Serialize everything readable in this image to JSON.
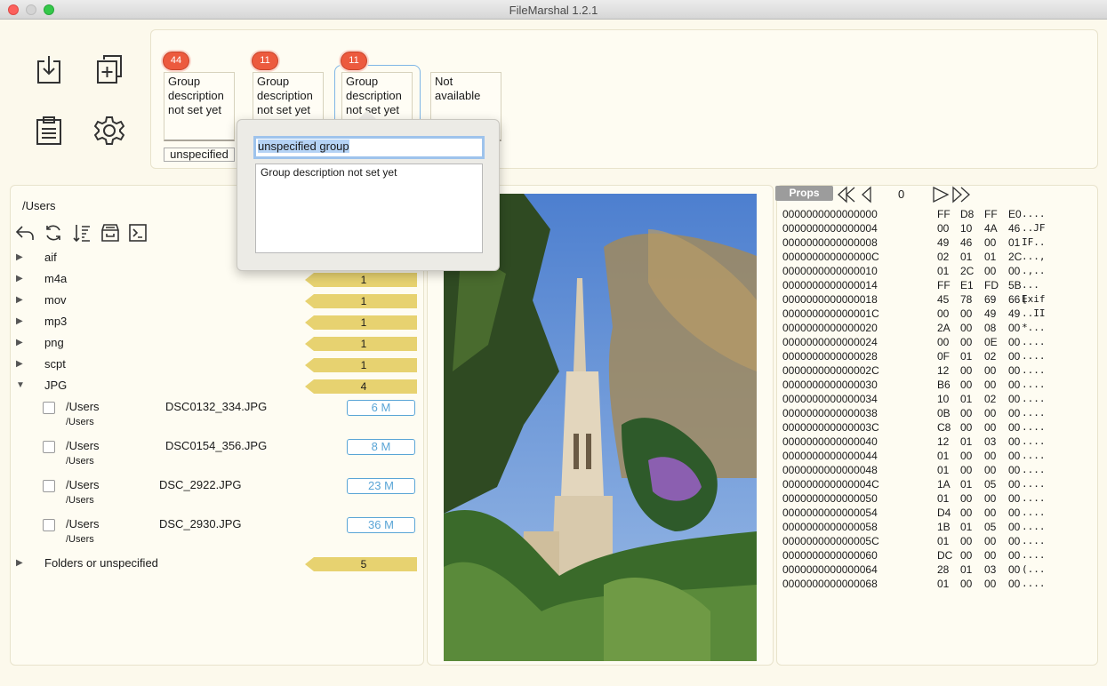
{
  "window": {
    "title": "FileMarshal 1.2.1"
  },
  "toolbar": {
    "icons": [
      "download-icon",
      "add-copy-icon",
      "clipboard-icon",
      "settings-icon"
    ]
  },
  "groups": [
    {
      "badge": "44",
      "description": "Group description not set yet",
      "label": "unspecified"
    },
    {
      "badge": "11",
      "description": "Group description not set yet",
      "label": ""
    },
    {
      "badge": "11",
      "description": "Group description not set yet",
      "label": ""
    },
    {
      "badge": "",
      "description": "Not available",
      "label": ""
    }
  ],
  "popover": {
    "name_value": "unspecified group",
    "description_value": "Group description not set yet"
  },
  "browser": {
    "path": "/Users",
    "tools": [
      "back-icon",
      "refresh-icon",
      "sort-icon",
      "archive-icon",
      "terminal-icon"
    ],
    "rows": [
      {
        "ext": "aif",
        "count": ""
      },
      {
        "ext": "m4a",
        "count": "1"
      },
      {
        "ext": "mov",
        "count": "1"
      },
      {
        "ext": "mp3",
        "count": "1"
      },
      {
        "ext": "png",
        "count": "1"
      },
      {
        "ext": "scpt",
        "count": "1"
      },
      {
        "ext": "JPG",
        "count": "4"
      }
    ],
    "files": [
      {
        "path": "/Users",
        "subpath": "/Users",
        "name": "DSC0132_334.JPG",
        "size": "6 M"
      },
      {
        "path": "/Users",
        "subpath": "/Users",
        "name": "DSC0154_356.JPG",
        "size": "8 M"
      },
      {
        "path": "/Users",
        "subpath": "/Users",
        "name": "DSC_2922.JPG",
        "size": "23 M"
      },
      {
        "path": "/Users",
        "subpath": "/Users",
        "name": "DSC_2930.JPG",
        "size": "36 M"
      }
    ],
    "footer_row": {
      "label": "Folders or unspecified",
      "count": "5"
    }
  },
  "props": {
    "button_label": "Props",
    "page": "0",
    "rows": [
      {
        "offset": "0000000000000000",
        "bytes": [
          "FF",
          "D8",
          "FF",
          "E0"
        ],
        "ascii": "...."
      },
      {
        "offset": "0000000000000004",
        "bytes": [
          "00",
          "10",
          "4A",
          "46"
        ],
        "ascii": "..JF"
      },
      {
        "offset": "0000000000000008",
        "bytes": [
          "49",
          "46",
          "00",
          "01"
        ],
        "ascii": "IF.."
      },
      {
        "offset": "000000000000000C",
        "bytes": [
          "02",
          "01",
          "01",
          "2C"
        ],
        "ascii": "...,"
      },
      {
        "offset": "0000000000000010",
        "bytes": [
          "01",
          "2C",
          "00",
          "00"
        ],
        "ascii": ".,.."
      },
      {
        "offset": "0000000000000014",
        "bytes": [
          "FF",
          "E1",
          "FD",
          "5B"
        ],
        "ascii": "...["
      },
      {
        "offset": "0000000000000018",
        "bytes": [
          "45",
          "78",
          "69",
          "66"
        ],
        "ascii": "Exif"
      },
      {
        "offset": "000000000000001C",
        "bytes": [
          "00",
          "00",
          "49",
          "49"
        ],
        "ascii": "..II"
      },
      {
        "offset": "0000000000000020",
        "bytes": [
          "2A",
          "00",
          "08",
          "00"
        ],
        "ascii": "*..."
      },
      {
        "offset": "0000000000000024",
        "bytes": [
          "00",
          "00",
          "0E",
          "00"
        ],
        "ascii": "...."
      },
      {
        "offset": "0000000000000028",
        "bytes": [
          "0F",
          "01",
          "02",
          "00"
        ],
        "ascii": "...."
      },
      {
        "offset": "000000000000002C",
        "bytes": [
          "12",
          "00",
          "00",
          "00"
        ],
        "ascii": "...."
      },
      {
        "offset": "0000000000000030",
        "bytes": [
          "B6",
          "00",
          "00",
          "00"
        ],
        "ascii": "...."
      },
      {
        "offset": "0000000000000034",
        "bytes": [
          "10",
          "01",
          "02",
          "00"
        ],
        "ascii": "...."
      },
      {
        "offset": "0000000000000038",
        "bytes": [
          "0B",
          "00",
          "00",
          "00"
        ],
        "ascii": "...."
      },
      {
        "offset": "000000000000003C",
        "bytes": [
          "C8",
          "00",
          "00",
          "00"
        ],
        "ascii": "...."
      },
      {
        "offset": "0000000000000040",
        "bytes": [
          "12",
          "01",
          "03",
          "00"
        ],
        "ascii": "...."
      },
      {
        "offset": "0000000000000044",
        "bytes": [
          "01",
          "00",
          "00",
          "00"
        ],
        "ascii": "...."
      },
      {
        "offset": "0000000000000048",
        "bytes": [
          "01",
          "00",
          "00",
          "00"
        ],
        "ascii": "...."
      },
      {
        "offset": "000000000000004C",
        "bytes": [
          "1A",
          "01",
          "05",
          "00"
        ],
        "ascii": "...."
      },
      {
        "offset": "0000000000000050",
        "bytes": [
          "01",
          "00",
          "00",
          "00"
        ],
        "ascii": "...."
      },
      {
        "offset": "0000000000000054",
        "bytes": [
          "D4",
          "00",
          "00",
          "00"
        ],
        "ascii": "...."
      },
      {
        "offset": "0000000000000058",
        "bytes": [
          "1B",
          "01",
          "05",
          "00"
        ],
        "ascii": "...."
      },
      {
        "offset": "000000000000005C",
        "bytes": [
          "01",
          "00",
          "00",
          "00"
        ],
        "ascii": "...."
      },
      {
        "offset": "0000000000000060",
        "bytes": [
          "DC",
          "00",
          "00",
          "00"
        ],
        "ascii": "...."
      },
      {
        "offset": "0000000000000064",
        "bytes": [
          "28",
          "01",
          "03",
          "00"
        ],
        "ascii": "(..."
      },
      {
        "offset": "0000000000000068",
        "bytes": [
          "01",
          "00",
          "00",
          "00"
        ],
        "ascii": "...."
      }
    ]
  },
  "colors": {
    "badge": "#ec5a3e",
    "count_bar": "#e7d270",
    "size_border": "#5aa5d6",
    "selection": "#b5d3f5",
    "background": "#fcf9ec"
  }
}
